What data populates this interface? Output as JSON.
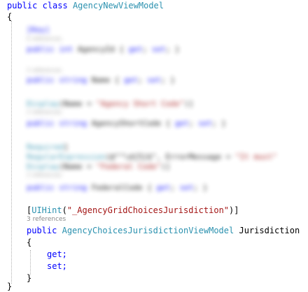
{
  "code": {
    "class_decl": {
      "public": "public",
      "class": "class",
      "name": "AgencyNewViewModel"
    },
    "open_brace": "{",
    "attribute": {
      "open_bracket": "[",
      "name": "UIHint",
      "open_paren": "(",
      "value": "\"_AgencyGridChoicesJurisdiction\"",
      "close": ")]"
    },
    "references": "3 references",
    "property_decl": {
      "public": "public",
      "type": "AgencyChoicesJurisdictionViewModel",
      "name": "Jurisdiction"
    },
    "prop_open_brace": "{",
    "get": "get;",
    "set": "set;",
    "prop_close_brace": "}",
    "close_brace": "}"
  },
  "colors": {
    "keyword": "#0000ff",
    "type": "#2b91af",
    "string": "#a31515",
    "plain": "#000000",
    "codelens": "#8a8a8a"
  }
}
